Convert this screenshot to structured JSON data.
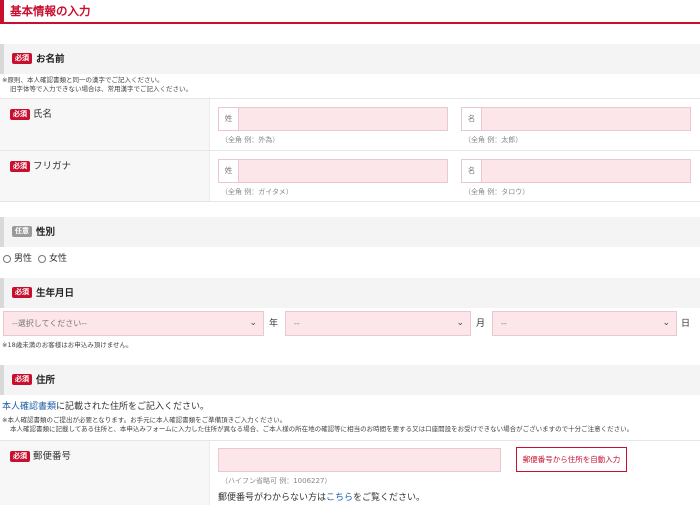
{
  "page_title": "基本情報の入力",
  "sections": {
    "name": {
      "badge": "必須",
      "label": "お名前"
    },
    "gender": {
      "badge": "任意",
      "label": "性別"
    },
    "birthday": {
      "badge": "必須",
      "label": "生年月日"
    },
    "address": {
      "badge": "必須",
      "label": "住所"
    }
  },
  "notes": {
    "name_line1": "※原則、本人確認書類と同一の漢字でご記入ください。",
    "name_line2": "旧字体等で入力できない場合は、常用漢字でご記入ください。",
    "birthday": "※18歳未満のお客様はお申込み頂けません。",
    "address_line1": "※本人確認書類のご提出が必要となります。お手元に本人確認書類をご準備頂きご入力ください。",
    "address_line2": "本人確認書類に記載してある住所と、本申込みフォームに入力した住所が異なる場合、ご本人様の所在地の確認等に相当のお時間を要する又は口座開設をお受けできない場合がございますので十分ご注意ください。"
  },
  "fields": {
    "fullname": {
      "badge": "必須",
      "label": "氏名",
      "sei_prefix": "姓",
      "mei_prefix": "名",
      "sei_hint": "（全角 例：外為）",
      "mei_hint": "（全角 例：太郎）"
    },
    "furigana": {
      "badge": "必須",
      "label": "フリガナ",
      "sei_prefix": "姓",
      "mei_prefix": "名",
      "sei_hint": "（全角 例：ガイタメ）",
      "mei_hint": "（全角 例：タロウ）"
    },
    "gender": {
      "male": "男性",
      "female": "女性"
    },
    "birthday": {
      "year_placeholder": "--選択してください--",
      "month_placeholder": "--",
      "day_placeholder": "--",
      "year_unit": "年",
      "month_unit": "月",
      "day_unit": "日"
    },
    "address": {
      "intro_link": "本人確認書類",
      "intro_text": "に記載された住所をご記入ください。"
    },
    "postal": {
      "badge": "必須",
      "label": "郵便番号",
      "hint": "（ハイフン省略可 例：1006227）",
      "autofill_button": "郵便番号から住所を自動入力",
      "help_before": "郵便番号がわからない方は",
      "help_link": "こちら",
      "help_after": "をご覧ください。"
    }
  },
  "colors": {
    "accent": "#c8102e",
    "field_bg": "#fde6ea",
    "link": "#1f5fa8"
  }
}
